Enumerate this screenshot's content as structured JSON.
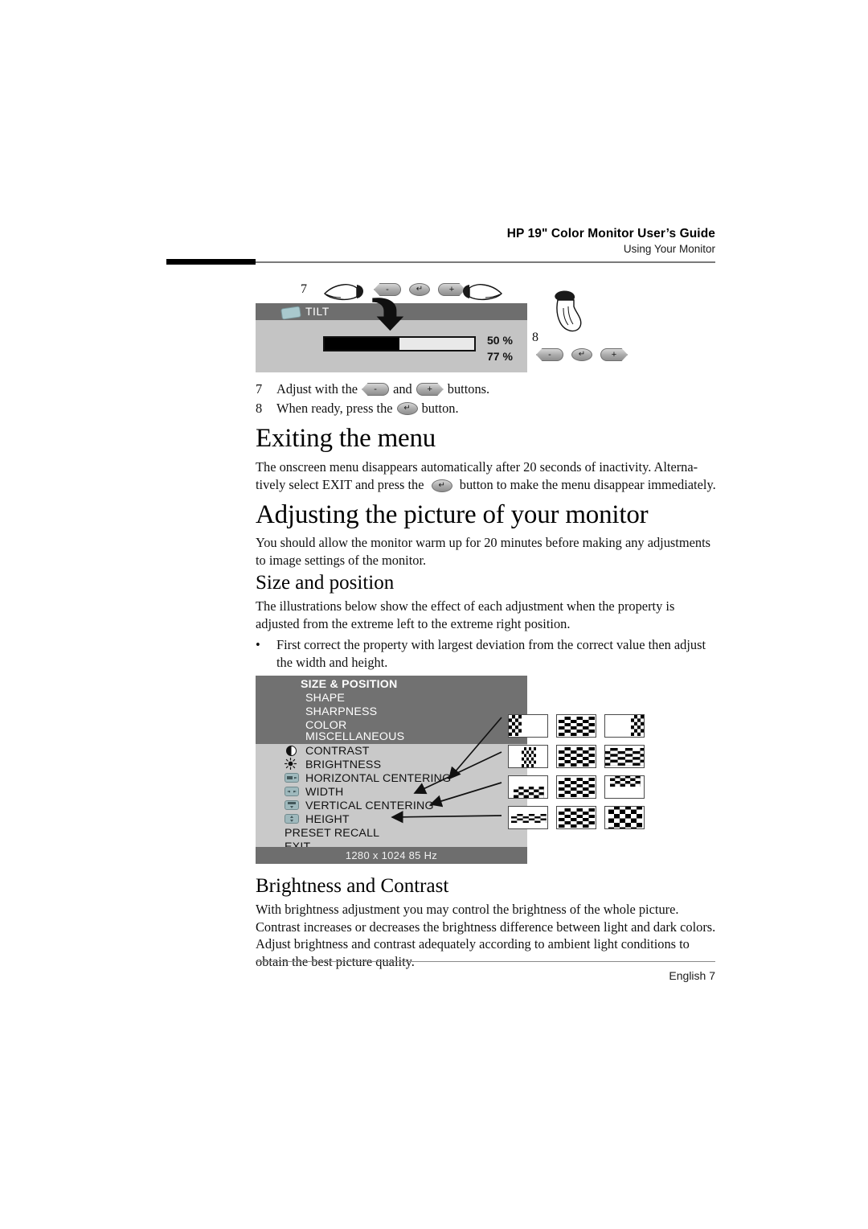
{
  "header": {
    "title": "HP 19\" Color Monitor User’s Guide",
    "subtitle": "Using Your Monitor"
  },
  "footer": {
    "page_label": "English 7"
  },
  "tilt_osd": {
    "title": "TILT",
    "icon": "tilt-monitor-icon",
    "value_top": "50 %",
    "value_bottom": "77 %",
    "bar_percent": 50,
    "callout_7": "7",
    "callout_8": "8",
    "button_minus": "-",
    "button_enter": "↵",
    "button_plus": "+"
  },
  "steps": [
    {
      "num": "7",
      "text_before": "Adjust with the",
      "text_middle": "and",
      "text_after": "buttons.",
      "btn_a": "-",
      "btn_b": "+"
    },
    {
      "num": "8",
      "text_before": "When ready, press the",
      "text_after": "button.",
      "btn_a": "↵"
    }
  ],
  "sections": [
    {
      "heading": "Exiting the menu",
      "paragraphs": [
        "The onscreen menu disappears automatically after 20 seconds of inactivity. Alterna-",
        "tively select EXIT and press the",
        "button to make the menu disappear immediately."
      ],
      "inline_button": "↵"
    },
    {
      "heading": "Adjusting the picture of your monitor",
      "paragraphs": [
        "You should allow the monitor warm up for 20 minutes before making any adjustments",
        "to image settings of the monitor."
      ]
    }
  ],
  "size_position": {
    "heading": "Size and position",
    "paragraphs": [
      "The illustrations below show the effect of each adjustment when the property is",
      "adjusted from the extreme left to the extreme right position."
    ],
    "bullet": {
      "marker": "•",
      "lines": [
        "First correct the property with largest deviation from the correct value then adjust",
        "the width and height."
      ]
    }
  },
  "brightness_contrast": {
    "heading": "Brightness and Contrast",
    "paragraphs": [
      "With brightness adjustment you may control the brightness of the whole picture.",
      "Contrast increases or decreases the brightness difference between light and dark colors.",
      "Adjust brightness and contrast adequately according to ambient light conditions to",
      "obtain the best picture quality."
    ]
  },
  "osd_menu": {
    "status_bar": "1280 x 1024  85 Hz",
    "header_items": [
      {
        "label": "SIZE & POSITION",
        "bold": true
      },
      {
        "label": "SHAPE",
        "bold": false
      },
      {
        "label": "SHARPNESS",
        "bold": false
      },
      {
        "label": "COLOR",
        "bold": false
      },
      {
        "label": "MISCELLANEOUS",
        "bold": false
      }
    ],
    "body_items": [
      {
        "label": "CONTRAST",
        "icon": "contrast-icon"
      },
      {
        "label": "BRIGHTNESS",
        "icon": "brightness-icon"
      },
      {
        "label": "HORIZONTAL CENTERING",
        "icon": "horizontal-centering-icon"
      },
      {
        "label": "WIDTH",
        "icon": "width-icon"
      },
      {
        "label": "VERTICAL CENTERING",
        "icon": "vertical-centering-icon"
      },
      {
        "label": "HEIGHT",
        "icon": "height-icon"
      },
      {
        "label": "PRESET RECALL",
        "icon": ""
      },
      {
        "label": "EXIT",
        "icon": ""
      }
    ]
  },
  "thumbnails": {
    "rows": [
      {
        "property": "HORIZONTAL CENTERING",
        "cells": [
          "left-extreme",
          "centered",
          "right-extreme"
        ]
      },
      {
        "property": "WIDTH",
        "cells": [
          "narrow",
          "normal",
          "wide"
        ]
      },
      {
        "property": "VERTICAL CENTERING",
        "cells": [
          "low",
          "centered",
          "high"
        ]
      },
      {
        "property": "HEIGHT",
        "cells": [
          "short",
          "normal",
          "tall"
        ]
      }
    ]
  },
  "colors": {
    "osd_header_gray": "#717171",
    "osd_body_gray": "#c9c9c9",
    "osd_status_gray": "#6e6e6e",
    "tilt_panel_gray": "#c4c4c4",
    "icon_teal": "#9fb9bd",
    "bar_fill": "#000000"
  }
}
